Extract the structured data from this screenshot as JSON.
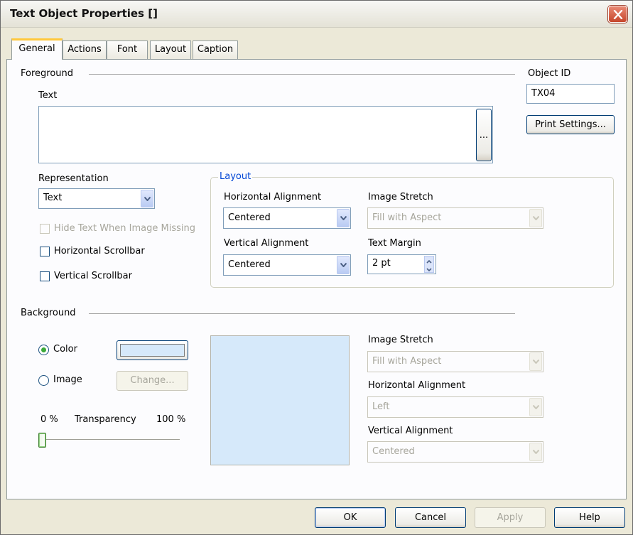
{
  "window": {
    "title": "Text Object Properties []"
  },
  "tabs": [
    {
      "label": "General",
      "active": true
    },
    {
      "label": "Actions",
      "active": false
    },
    {
      "label": "Font",
      "active": false
    },
    {
      "label": "Layout",
      "active": false
    },
    {
      "label": "Caption",
      "active": false
    }
  ],
  "foreground": {
    "section_label": "Foreground",
    "text_label": "Text",
    "text_value": "",
    "browse_label": "...",
    "object_id_label": "Object ID",
    "object_id_value": "TX04",
    "print_settings_label": "Print Settings...",
    "representation_label": "Representation",
    "representation_value": "Text",
    "hide_text_label": "Hide Text When Image Missing",
    "hide_text_checked": false,
    "hide_text_enabled": false,
    "h_scrollbar_label": "Horizontal Scrollbar",
    "h_scrollbar_checked": false,
    "v_scrollbar_label": "Vertical Scrollbar",
    "v_scrollbar_checked": false
  },
  "layout": {
    "group_label": "Layout",
    "h_align_label": "Horizontal Alignment",
    "h_align_value": "Centered",
    "v_align_label": "Vertical Alignment",
    "v_align_value": "Centered",
    "image_stretch_label": "Image Stretch",
    "image_stretch_value": "Fill with Aspect",
    "text_margin_label": "Text Margin",
    "text_margin_value": "2 pt"
  },
  "background": {
    "section_label": "Background",
    "color_radio_label": "Color",
    "color_selected": true,
    "image_radio_label": "Image",
    "image_selected": false,
    "change_label": "Change...",
    "transparency_min": "0 %",
    "transparency_label": "Transparency",
    "transparency_max": "100 %",
    "transparency_value": 0,
    "color_value": "#d6e9fa",
    "image_stretch_label": "Image Stretch",
    "image_stretch_value": "Fill with Aspect",
    "h_align_label": "Horizontal Alignment",
    "h_align_value": "Left",
    "v_align_label": "Vertical Alignment",
    "v_align_value": "Centered"
  },
  "footer": {
    "ok_label": "OK",
    "cancel_label": "Cancel",
    "apply_label": "Apply",
    "help_label": "Help"
  },
  "colors": {
    "accent_tab": "#ffc83c",
    "group_title": "#0046d5",
    "close_button": "#c6462b"
  }
}
